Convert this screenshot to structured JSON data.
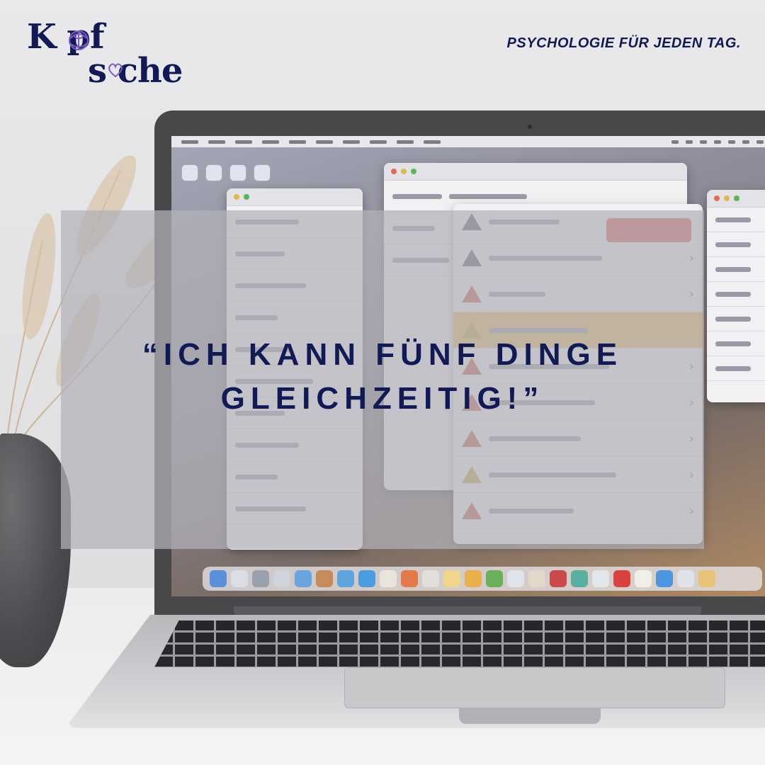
{
  "header": {
    "logo_line1": "K  pf",
    "logo_line2": "s  che",
    "tagline": "PSYCHOLOGIE FÜR JEDEN TAG."
  },
  "quote": {
    "line1": "“ICH KANN FÜNF DINGE",
    "line2": "GLEICHZEITIG!”"
  },
  "colors": {
    "brand_navy": "#111a55",
    "logo_accent": "#7b5cc4",
    "overlay": "#b2b2b8",
    "alert_red": "#d9584b",
    "alert_amber": "#e7b85e"
  },
  "icons": [
    "brain-icon",
    "heart-icon",
    "warning-icon"
  ]
}
